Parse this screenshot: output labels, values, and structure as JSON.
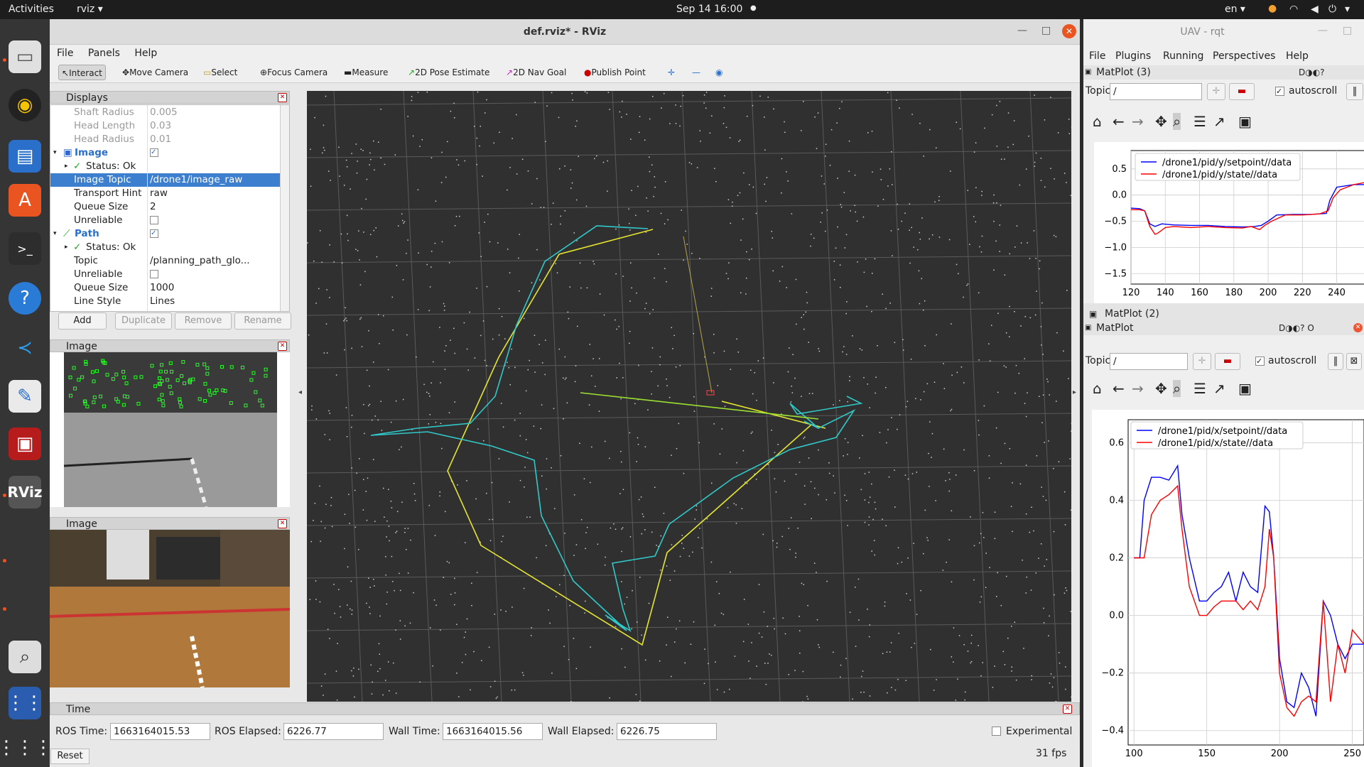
{
  "topbar": {
    "activities": "Activities",
    "app": "rviz ▾",
    "clock": "Sep 14  16:00",
    "lang": "en ▾"
  },
  "rviz": {
    "title": "def.rviz* - RViz",
    "menu": [
      "File",
      "Panels",
      "Help"
    ],
    "toolbar": [
      "Interact",
      "Move Camera",
      "Select",
      "Focus Camera",
      "Measure",
      "2D Pose Estimate",
      "2D Nav Goal",
      "Publish Point"
    ],
    "displays": {
      "title": "Displays",
      "rows": [
        {
          "k": "Shaft Radius",
          "v": "0.005",
          "grey": true
        },
        {
          "k": "Head Length",
          "v": "0.03",
          "grey": true
        },
        {
          "k": "Head Radius",
          "v": "0.01",
          "grey": true
        },
        {
          "k": "Image",
          "v": "✓",
          "group": true
        },
        {
          "k": "Status: Ok",
          "v": ""
        },
        {
          "k": "Image Topic",
          "v": "/drone1/image_raw",
          "sel": true
        },
        {
          "k": "Transport Hint",
          "v": "raw"
        },
        {
          "k": "Queue Size",
          "v": "2"
        },
        {
          "k": "Unreliable",
          "v": ""
        },
        {
          "k": "Path",
          "v": "✓",
          "group": true
        },
        {
          "k": "Status: Ok",
          "v": ""
        },
        {
          "k": "Topic",
          "v": "/planning_path_glo..."
        },
        {
          "k": "Unreliable",
          "v": ""
        },
        {
          "k": "Queue Size",
          "v": "1000"
        },
        {
          "k": "Line Style",
          "v": "Lines"
        }
      ],
      "buttons": [
        "Add",
        "Duplicate",
        "Remove",
        "Rename"
      ]
    },
    "image_panel1": "Image",
    "image_panel2": "Image",
    "time": {
      "title": "Time",
      "ros_time_label": "ROS Time:",
      "ros_time": "1663164015.53",
      "ros_elapsed_label": "ROS Elapsed:",
      "ros_elapsed": "6226.77",
      "wall_time_label": "Wall Time:",
      "wall_time": "1663164015.56",
      "wall_elapsed_label": "Wall Elapsed:",
      "wall_elapsed": "6226.75",
      "experimental": "Experimental",
      "reset": "Reset",
      "fps": "31 fps"
    }
  },
  "rqt": {
    "title": "UAV - rqt",
    "menu": [
      "File",
      "Plugins",
      "Running",
      "Perspectives",
      "Help"
    ],
    "plot1": {
      "title": "MatPlot (3)",
      "topic_label": "Topic",
      "topic": "/",
      "autoscroll": "autoscroll"
    },
    "plot2_tab": "MatPlot (2)",
    "plot3": {
      "title": "MatPlot",
      "topic_label": "Topic",
      "topic": "/",
      "autoscroll": "autoscroll"
    }
  },
  "chart_data": [
    {
      "type": "line",
      "title": "",
      "xlim": [
        120,
        258
      ],
      "ylim": [
        -1.7,
        0.85
      ],
      "xticks": [
        120,
        140,
        160,
        180,
        200,
        220,
        240
      ],
      "yticks": [
        0.5,
        0.0,
        -0.5,
        -1.0,
        -1.5
      ],
      "series": [
        {
          "name": "/drone1/pid/y/setpoint//data",
          "color": "#0000ff",
          "x": [
            120,
            125,
            128,
            131,
            134,
            138,
            145,
            155,
            165,
            175,
            185,
            192,
            196,
            200,
            205,
            215,
            225,
            234,
            236,
            240,
            250,
            258
          ],
          "y": [
            -0.25,
            -0.26,
            -0.3,
            -0.55,
            -0.6,
            -0.55,
            -0.57,
            -0.58,
            -0.58,
            -0.6,
            -0.61,
            -0.6,
            -0.58,
            -0.5,
            -0.38,
            -0.37,
            -0.37,
            -0.35,
            -0.1,
            0.15,
            0.2,
            0.2
          ]
        },
        {
          "name": "/drone1/pid/y/state//data",
          "color": "#ff0000",
          "x": [
            120,
            125,
            128,
            131,
            134,
            136,
            140,
            145,
            155,
            165,
            175,
            185,
            190,
            195,
            198,
            202,
            210,
            220,
            230,
            235,
            238,
            242,
            250,
            258
          ],
          "y": [
            -0.28,
            -0.28,
            -0.3,
            -0.6,
            -0.75,
            -0.72,
            -0.62,
            -0.6,
            -0.62,
            -0.6,
            -0.62,
            -0.63,
            -0.6,
            -0.66,
            -0.58,
            -0.5,
            -0.38,
            -0.38,
            -0.36,
            -0.3,
            -0.05,
            0.1,
            0.2,
            0.25
          ]
        }
      ]
    },
    {
      "type": "line",
      "title": "",
      "xlim": [
        96,
        258
      ],
      "ylim": [
        -0.45,
        0.68
      ],
      "xticks": [
        100,
        150,
        200,
        250
      ],
      "yticks": [
        0.6,
        0.4,
        0.2,
        0.0,
        -0.2,
        -0.4
      ],
      "series": [
        {
          "name": "/drone1/pid/x/setpoint//data",
          "color": "#0000ff",
          "x": [
            100,
            104,
            107,
            112,
            118,
            124,
            130,
            133,
            138,
            145,
            150,
            155,
            160,
            165,
            170,
            175,
            180,
            185,
            190,
            193,
            196,
            200,
            205,
            210,
            215,
            220,
            225,
            230,
            235,
            240,
            245,
            250,
            258
          ],
          "y": [
            0.2,
            0.2,
            0.4,
            0.48,
            0.48,
            0.47,
            0.52,
            0.35,
            0.2,
            0.05,
            0.05,
            0.08,
            0.1,
            0.15,
            0.05,
            0.15,
            0.1,
            0.08,
            0.38,
            0.36,
            0.2,
            -0.15,
            -0.3,
            -0.32,
            -0.2,
            -0.25,
            -0.35,
            0.05,
            0.0,
            -0.1,
            -0.15,
            -0.1,
            -0.1
          ]
        },
        {
          "name": "/drone1/pid/x/state//data",
          "color": "#ff0000",
          "x": [
            100,
            104,
            107,
            112,
            118,
            124,
            130,
            133,
            138,
            145,
            150,
            155,
            160,
            165,
            170,
            175,
            180,
            185,
            190,
            193,
            196,
            200,
            205,
            210,
            215,
            220,
            225,
            230,
            235,
            240,
            245,
            250,
            258
          ],
          "y": [
            0.2,
            0.2,
            0.2,
            0.35,
            0.4,
            0.42,
            0.45,
            0.3,
            0.1,
            0.0,
            0.0,
            0.03,
            0.05,
            0.05,
            0.05,
            0.02,
            0.05,
            0.02,
            0.1,
            0.3,
            0.2,
            -0.2,
            -0.32,
            -0.35,
            -0.3,
            -0.28,
            -0.3,
            0.05,
            -0.3,
            -0.1,
            -0.2,
            -0.05,
            -0.1
          ]
        }
      ]
    }
  ]
}
